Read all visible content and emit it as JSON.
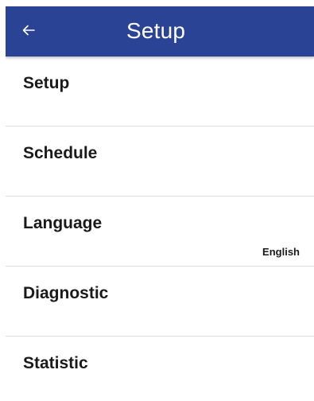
{
  "appbar": {
    "title": "Setup",
    "back_icon": "arrow-left-icon",
    "color": "#2b4394"
  },
  "menu": {
    "items": [
      {
        "label": "Setup",
        "value": ""
      },
      {
        "label": "Schedule",
        "value": ""
      },
      {
        "label": "Language",
        "value": "English"
      },
      {
        "label": "Diagnostic",
        "value": ""
      },
      {
        "label": "Statistic",
        "value": ""
      }
    ]
  }
}
